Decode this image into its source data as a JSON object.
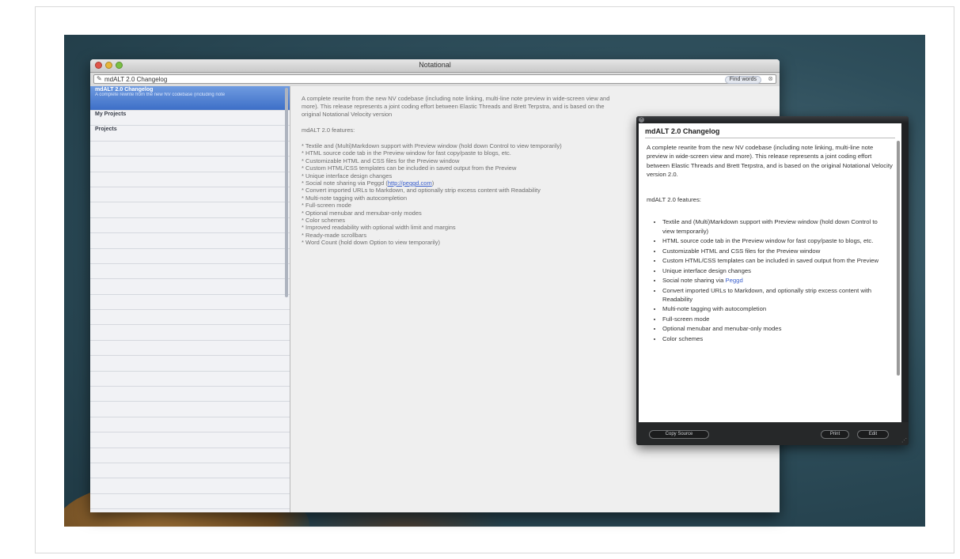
{
  "window": {
    "title": "Notational"
  },
  "search": {
    "value": "mdALT 2.0 Changelog",
    "button": "Find words"
  },
  "notes": [
    {
      "title": "mdALT 2.0 Changelog",
      "date": "",
      "preview": "A complete rewrite from the new NV codebase (including note",
      "selected": true
    },
    {
      "title": "My Projects",
      "date": "",
      "preview": ""
    },
    {
      "title": "Projects",
      "date": "",
      "preview": ""
    },
    {
      "title": "",
      "date": "",
      "preview": ""
    },
    {
      "title": "",
      "date": "",
      "preview": ""
    },
    {
      "title": "",
      "date": "",
      "preview": ""
    },
    {
      "title": "",
      "date": "",
      "preview": ""
    },
    {
      "title": "",
      "date": "",
      "preview": ""
    },
    {
      "title": "",
      "date": "",
      "preview": ""
    },
    {
      "title": "",
      "date": "",
      "preview": ""
    },
    {
      "title": "",
      "date": "",
      "preview": ""
    },
    {
      "title": "",
      "date": "",
      "preview": ""
    },
    {
      "title": "",
      "date": "",
      "preview": ""
    },
    {
      "title": "",
      "date": "",
      "preview": ""
    },
    {
      "title": "",
      "date": "",
      "preview": ""
    },
    {
      "title": "",
      "date": "",
      "preview": ""
    },
    {
      "title": "",
      "date": "",
      "preview": ""
    },
    {
      "title": "",
      "date": "",
      "preview": ""
    },
    {
      "title": "",
      "date": "",
      "preview": ""
    },
    {
      "title": "",
      "date": "",
      "preview": ""
    },
    {
      "title": "",
      "date": "",
      "preview": ""
    },
    {
      "title": "",
      "date": "",
      "preview": ""
    },
    {
      "title": "",
      "date": "",
      "preview": ""
    },
    {
      "title": "",
      "date": "",
      "preview": ""
    },
    {
      "title": "",
      "date": "",
      "preview": ""
    },
    {
      "title": "",
      "date": "",
      "preview": ""
    },
    {
      "title": "",
      "date": "",
      "preview": ""
    },
    {
      "title": "",
      "date": "",
      "preview": ""
    }
  ],
  "editor": {
    "intro": [
      "A complete rewrite from the new NV codebase (including note linking, multi-line note preview in wide-screen view and",
      "more). This release represents a joint coding effort between Elastic Threads and Brett Terpstra, and is based on the",
      "original Notational Velocity version"
    ],
    "features_heading": "mdALT 2.0 features:",
    "features": [
      "Textile and (Multi)Markdown support with Preview window (hold down Control to view temporarily)",
      "HTML source code tab in the Preview window for fast copy/paste to blogs, etc.",
      "Customizable HTML and CSS files for the Preview window",
      "Custom HTML/CSS templates can be included in saved output from the Preview",
      "Unique interface design changes",
      "Social note sharing via Peggd",
      "Convert imported URLs to Markdown, and optionally strip excess content with Readability",
      "Multi-note tagging with autocompletion",
      "Full-screen mode",
      "Optional menubar and menubar-only modes",
      "Color schemes",
      "Improved readability with optional width limit and margins",
      "Ready-made scrollbars",
      "Word Count (hold down Option to view temporarily)"
    ],
    "link_text": "http://peggd.com"
  },
  "preview": {
    "title": "mdALT 2.0 Changelog",
    "intro": "A complete rewrite from the new NV codebase (including note linking, multi-line note preview in wide-screen view and more). This release represents a joint coding effort between Elastic Threads and Brett Terpstra, and is based on the original Notational Velocity version 2.0.",
    "features_heading": "mdALT 2.0 features:",
    "features": [
      "Textile and (Multi)Markdown support with Preview window (hold down Control to view temporarily)",
      "HTML source code tab in the Preview window for fast copy/paste to blogs, etc.",
      "Customizable HTML and CSS files for the Preview window",
      "Custom HTML/CSS templates can be included in saved output from the Preview",
      "Unique interface design changes",
      "Social note sharing via Peggd",
      "Convert imported URLs to Markdown, and optionally strip excess content with Readability",
      "Multi-note tagging with autocompletion",
      "Full-screen mode",
      "Optional menubar and menubar-only modes",
      "Color schemes"
    ],
    "link_word": "Peggd",
    "buttons": {
      "copy": "Copy Source",
      "print": "Print",
      "edit": "Edit"
    }
  },
  "icons": {
    "pencil": "pencil-icon",
    "clear": "clear-search-icon",
    "close": "close-icon",
    "grip": "resize-grip-icon"
  }
}
